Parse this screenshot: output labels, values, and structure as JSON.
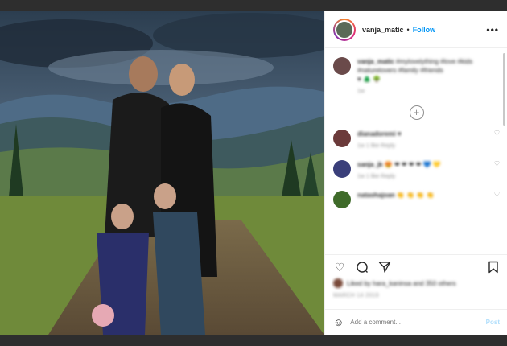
{
  "header": {
    "username": "vanja_matic",
    "separator": "•",
    "follow_label": "Follow",
    "more_label": "•••"
  },
  "caption": {
    "username": "vanja_matic",
    "text": "#mylovelything #love #kids #naturelovers #family #friends",
    "emojis": "♥ 🌲 🌳",
    "meta": "1w"
  },
  "load_more": "+",
  "comments": [
    {
      "user": "dianadoremi",
      "text": "♥",
      "meta": "1w  1 like  Reply",
      "avatar_color": "#6b3a3a"
    },
    {
      "user": "sanja_jk",
      "text": "😍 ❤ ❤ ❤ ❤ 💙 💛",
      "meta": "1w  1 like  Reply",
      "avatar_color": "#3a3f7a"
    },
    {
      "user": "natashajoan",
      "text": "👏 👏 👏 👏",
      "meta": "",
      "avatar_color": "#3f6b2a"
    }
  ],
  "likes_text": "Liked by hara_kaninsa and 350 others",
  "date_text": "MARCH 14 2019",
  "add_comment_placeholder": "Add a comment...",
  "post_label": "Post",
  "colors": {
    "follow": "#0095f6",
    "post_disabled": "#b2dffc"
  }
}
